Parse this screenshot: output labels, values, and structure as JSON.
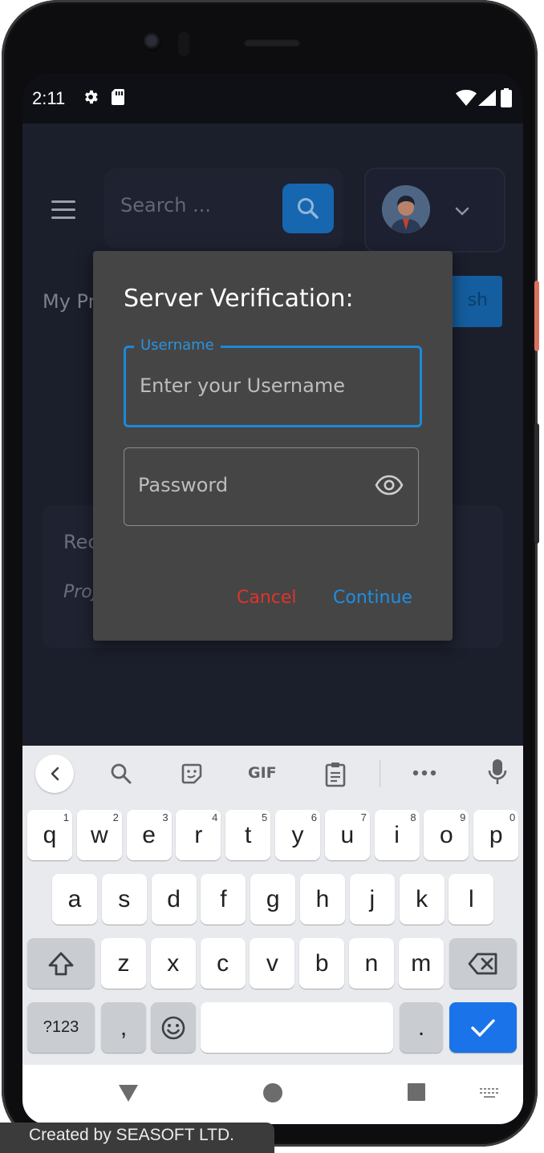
{
  "status_bar": {
    "time": "2:11"
  },
  "app": {
    "search_placeholder": "Search ...",
    "background_title_fragment": "My Pr",
    "background_button_fragment": "sh",
    "card_title_fragment": "Rec",
    "card_subtitle_fragment": "Proj"
  },
  "dialog": {
    "title": "Server Verification:",
    "username_label": "Username",
    "username_placeholder": "Enter your Username",
    "password_placeholder": "Password",
    "cancel_label": "Cancel",
    "continue_label": "Continue"
  },
  "keyboard": {
    "toolbar": [
      "back",
      "search",
      "sticker",
      "GIF",
      "clipboard",
      "more",
      "mic"
    ],
    "gif_label": "GIF",
    "row1": [
      {
        "k": "q",
        "h": "1"
      },
      {
        "k": "w",
        "h": "2"
      },
      {
        "k": "e",
        "h": "3"
      },
      {
        "k": "r",
        "h": "4"
      },
      {
        "k": "t",
        "h": "5"
      },
      {
        "k": "y",
        "h": "6"
      },
      {
        "k": "u",
        "h": "7"
      },
      {
        "k": "i",
        "h": "8"
      },
      {
        "k": "o",
        "h": "9"
      },
      {
        "k": "p",
        "h": "0"
      }
    ],
    "row2": [
      "a",
      "s",
      "d",
      "f",
      "g",
      "h",
      "j",
      "k",
      "l"
    ],
    "row3": [
      "z",
      "x",
      "c",
      "v",
      "b",
      "n",
      "m"
    ],
    "symbols_label": "?123",
    "comma_label": ",",
    "period_label": "."
  },
  "colors": {
    "accent_blue": "#1e8fe4",
    "cancel_red": "#e0332b",
    "dialog_bg": "#454545",
    "enter_key": "#1a73e8"
  },
  "footer": {
    "credit": "Created by SEASOFT LTD."
  }
}
